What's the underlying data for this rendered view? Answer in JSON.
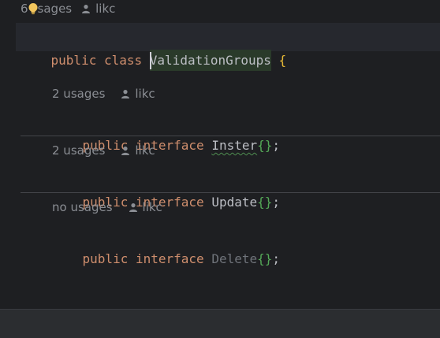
{
  "editor": {
    "header_usages_prefix": "6",
    "header_usages_suffix": "sages",
    "header_author": "likc",
    "line1": {
      "kw1": "public",
      "kw2": "class",
      "name": "ValidationGroups",
      "brace": "{"
    },
    "members": [
      {
        "usages": "2 usages",
        "author": "likc",
        "kw1": "public",
        "kw2": "interface",
        "name": "Inster",
        "braces": "{}",
        "semi": ";"
      },
      {
        "usages": "2 usages",
        "author": "likc",
        "kw1": "public",
        "kw2": "interface",
        "name": "Update",
        "braces": "{}",
        "semi": ";"
      },
      {
        "usages": "no usages",
        "author": "likc",
        "kw1": "public",
        "kw2": "interface",
        "name": "Delete",
        "braces": "{}",
        "semi": ";"
      }
    ],
    "closing_brace": "}"
  },
  "colors": {
    "background": "#1e1f22",
    "keyword": "#cf8e6d",
    "brace_yellow": "#e8ba36",
    "brace_green": "#54a857",
    "inlay_hint": "#8b8e94",
    "unused_symbol": "#6f737a",
    "intention_bulb": "#f2c55c"
  },
  "icons": {
    "intention": "lightbulb-icon",
    "author": "user-icon"
  }
}
